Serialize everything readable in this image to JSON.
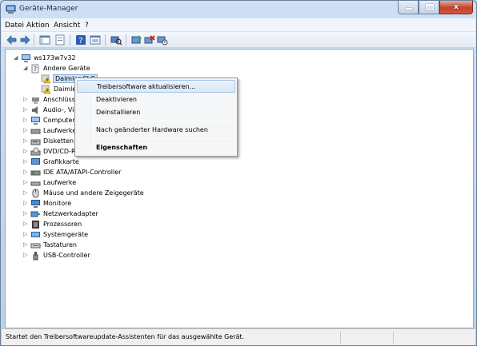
{
  "window": {
    "title": "Geräte-Manager",
    "caption": {
      "minimize": "_",
      "maximize": "□",
      "close": "x"
    }
  },
  "menu": [
    "Datei",
    "Aktion",
    "Ansicht",
    "?"
  ],
  "tree": {
    "root": "ws173w7v32",
    "other_devices": "Andere Geräte",
    "other_children": [
      "Daimler CLC",
      "Daimler"
    ],
    "categories": [
      "Anschlüsse (COM & LPT)",
      "Audio-, Video- und Gamecontroller",
      "Computer",
      "Laufwerke",
      "Disketten",
      "DVD/CD-ROM-Laufwerke",
      "Grafikkarte",
      "IDE ATA/ATAPI-Controller",
      "Laufwerke",
      "Mäuse und andere Zeigegeräte",
      "Monitore",
      "Netzwerkadapter",
      "Prozessoren",
      "Systemgeräte",
      "Tastaturen",
      "USB-Controller"
    ]
  },
  "context_menu": {
    "update_driver": "Treibersoftware aktualisieren...",
    "disable": "Deaktivieren",
    "uninstall": "Deinstallieren",
    "scan": "Nach geänderter Hardware suchen",
    "properties": "Eigenschaften"
  },
  "status": "Startet den Treibersoftwareupdate-Assistenten für das ausgewählte Gerät.",
  "colors": {
    "accent": "#3878c8",
    "selection": "#cce4f7",
    "warning": "#e0a800"
  }
}
